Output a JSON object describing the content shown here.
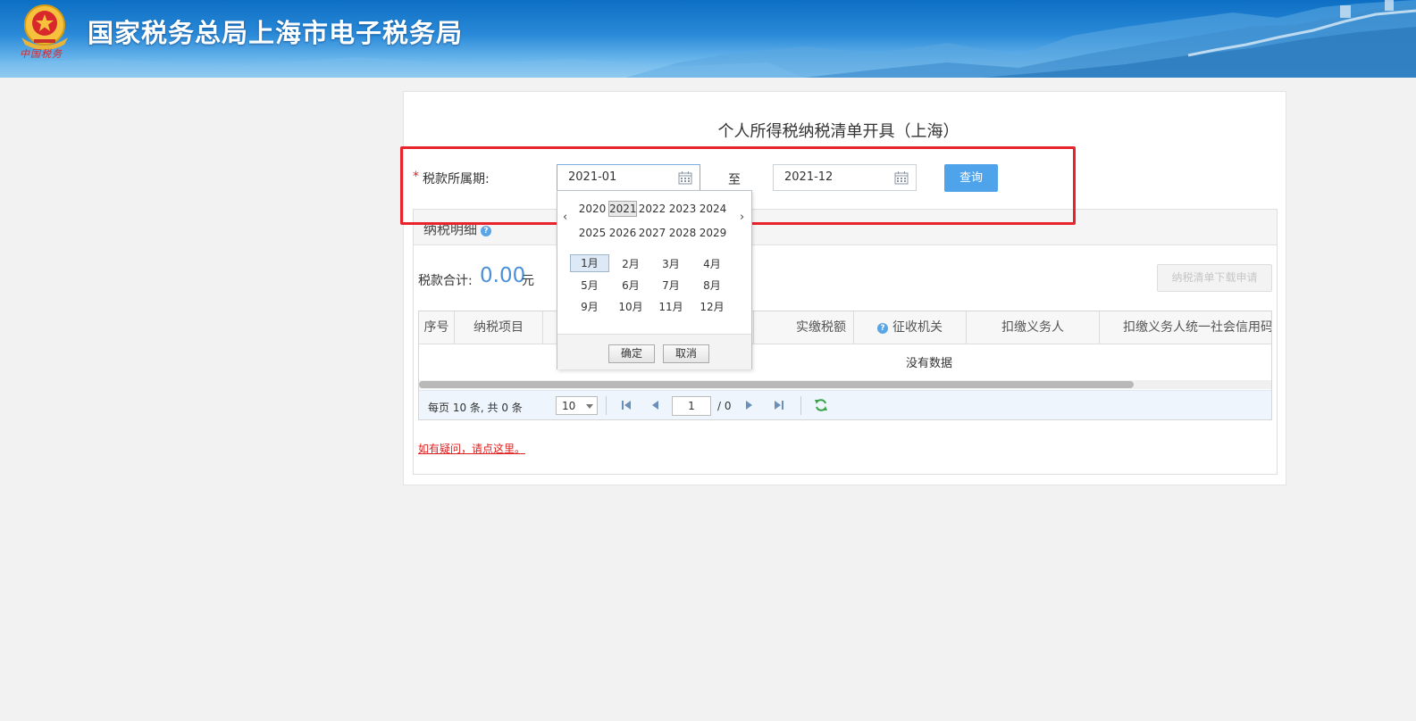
{
  "header": {
    "title": "国家税务总局上海市电子税务局",
    "emblem_caption": "中国税务"
  },
  "form": {
    "page_title": "个人所得税纳税清单开具（上海）",
    "required_mark": "*",
    "period_label": "税款所属期:",
    "start_period": "2021-01",
    "to_label": "至",
    "end_period": "2021-12",
    "query_button": "查询"
  },
  "details": {
    "section_title": "纳税明细",
    "tax_total_label": "税款合计:",
    "tax_total_value": "0.00",
    "tax_total_unit": "元",
    "download_button": "纳税清单下载申请",
    "columns": [
      "序号",
      "纳税项目",
      "",
      "实缴税额",
      "征收机关",
      "扣缴义务人",
      "扣缴义务人统一社会信用码"
    ],
    "empty_text": "没有数据",
    "pager": {
      "info": "每页 10 条, 共 0 条",
      "page_size": "10",
      "current_page": "1",
      "total_pages": "/ 0"
    }
  },
  "help_link": "如有疑问，请点这里。",
  "month_picker": {
    "prev": "‹",
    "next": "›",
    "years_row1": [
      "2020",
      "2021",
      "2022",
      "2023",
      "2024"
    ],
    "years_row2": [
      "2025",
      "2026",
      "2027",
      "2028",
      "2029"
    ],
    "selected_year": "2021",
    "months": [
      "1月",
      "2月",
      "3月",
      "4月",
      "5月",
      "6月",
      "7月",
      "8月",
      "9月",
      "10月",
      "11月",
      "12月"
    ],
    "selected_month": "1月",
    "confirm_button": "确定",
    "cancel_button": "取消"
  },
  "colors": {
    "banner": "#1a7bd0",
    "query_button": "#4fa3ea",
    "highlight": "#e8232c",
    "total_value": "#4a90d9",
    "help_link": "#e02020"
  }
}
